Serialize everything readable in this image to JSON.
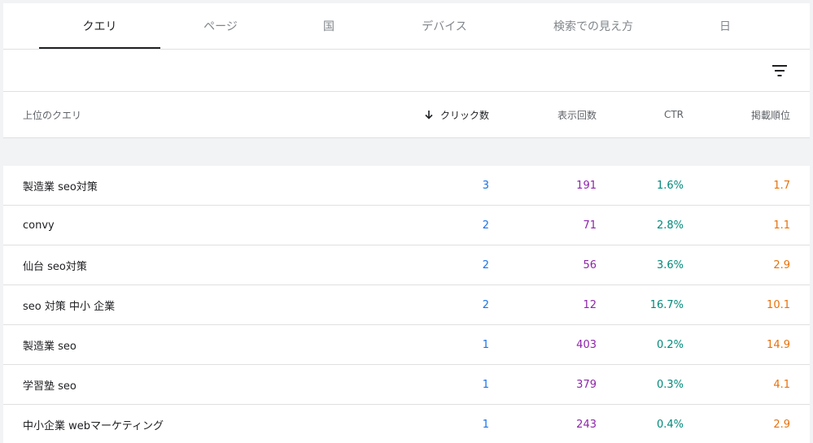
{
  "tabs": [
    {
      "label": "クエリ",
      "active": true
    },
    {
      "label": "ページ",
      "active": false
    },
    {
      "label": "国",
      "active": false
    },
    {
      "label": "デバイス",
      "active": false
    },
    {
      "label": "検索での見え方",
      "active": false
    },
    {
      "label": "日",
      "active": false
    }
  ],
  "toolbar": {
    "filter_icon": "filter-list-icon"
  },
  "table": {
    "headers": {
      "query": "上位のクエリ",
      "clicks": "クリック数",
      "impressions": "表示回数",
      "ctr": "CTR",
      "position": "掲載順位"
    },
    "sort": {
      "column": "clicks",
      "direction": "descending",
      "icon": "arrow-down-icon"
    },
    "rows": [
      {
        "query": "製造業 seo対策",
        "clicks": "3",
        "impressions": "191",
        "ctr": "1.6%",
        "position": "1.7"
      },
      {
        "query": "convy",
        "clicks": "2",
        "impressions": "71",
        "ctr": "2.8%",
        "position": "1.1"
      },
      {
        "query": "仙台 seo対策",
        "clicks": "2",
        "impressions": "56",
        "ctr": "3.6%",
        "position": "2.9"
      },
      {
        "query": "seo 対策 中小 企業",
        "clicks": "2",
        "impressions": "12",
        "ctr": "16.7%",
        "position": "10.1"
      },
      {
        "query": "製造業 seo",
        "clicks": "1",
        "impressions": "403",
        "ctr": "0.2%",
        "position": "14.9"
      },
      {
        "query": "学習塾 seo",
        "clicks": "1",
        "impressions": "379",
        "ctr": "0.3%",
        "position": "4.1"
      },
      {
        "query": "中小企業 webマーケティング",
        "clicks": "1",
        "impressions": "243",
        "ctr": "0.4%",
        "position": "2.9"
      }
    ]
  },
  "colors": {
    "clicks": "#1a73e8",
    "impressions": "#8e24aa",
    "ctr": "#00897b",
    "position": "#e8710a"
  }
}
